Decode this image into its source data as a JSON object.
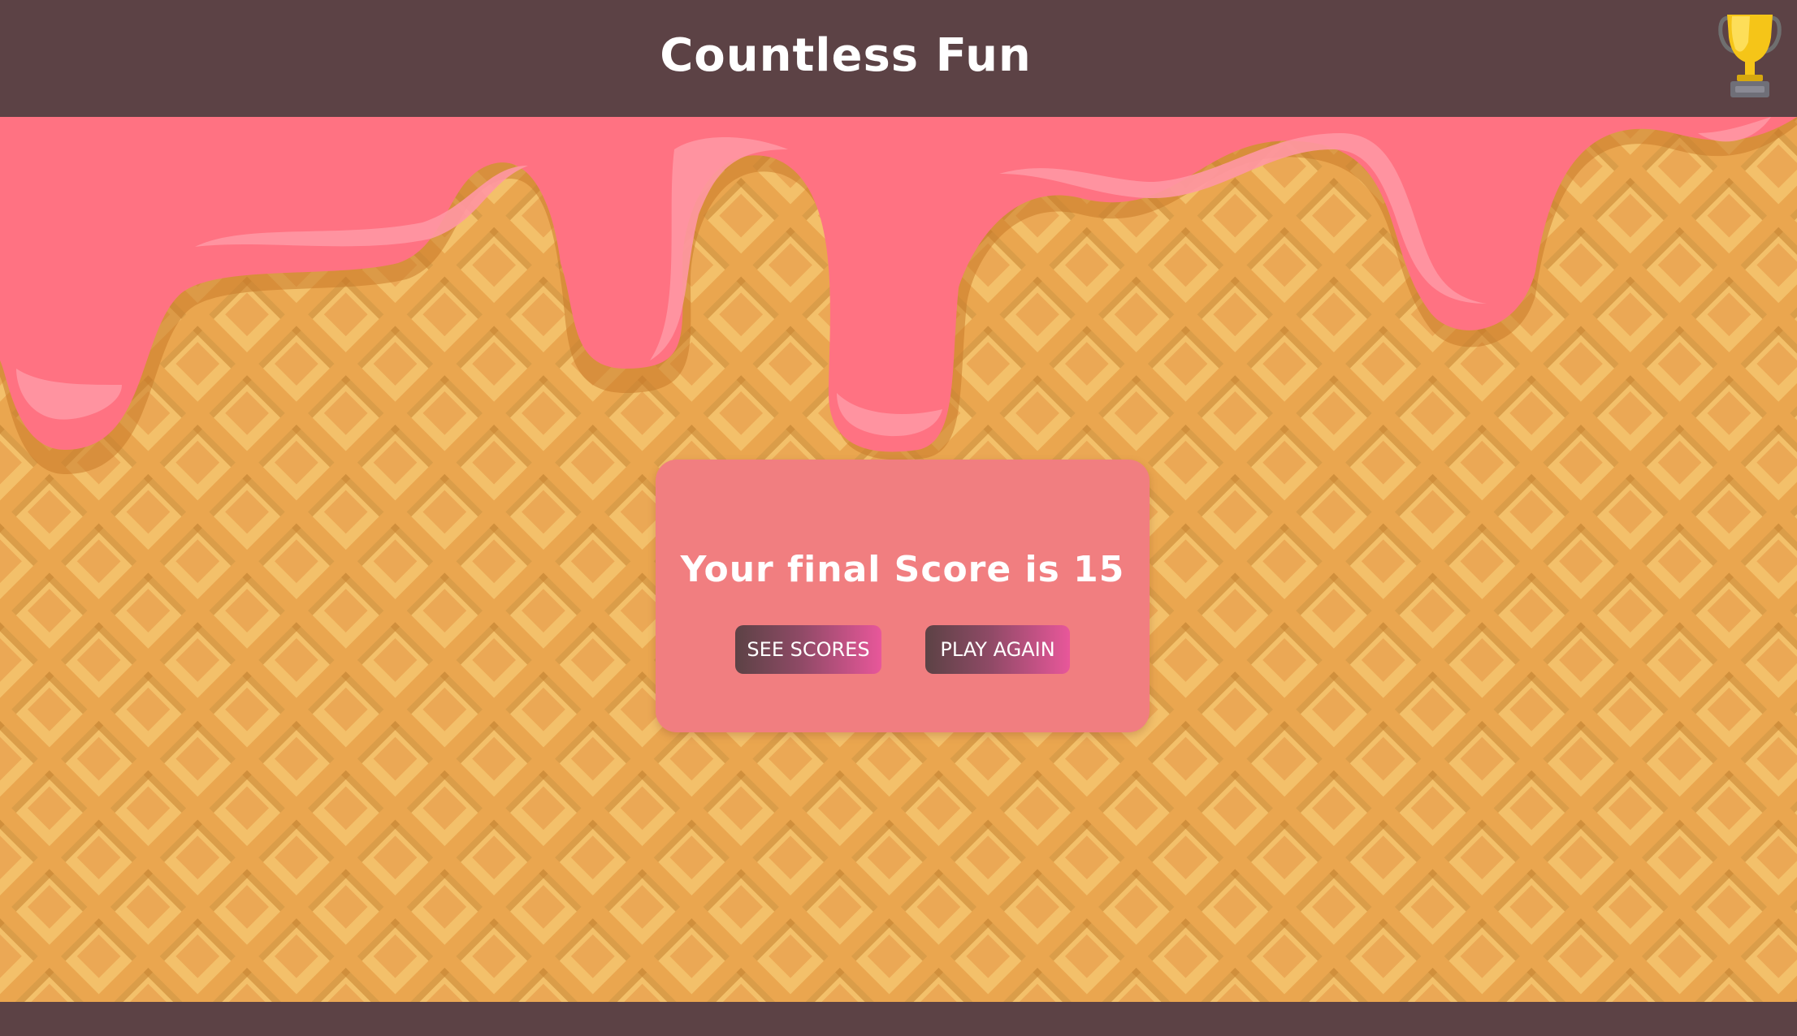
{
  "header": {
    "title": "Countless Fun",
    "trophy_icon": "trophy-icon"
  },
  "result": {
    "score_text": "Your final Score is 15",
    "see_scores_label": "SEE SCORES",
    "play_again_label": "PLAY AGAIN"
  },
  "colors": {
    "header_bg": "#5c4245",
    "icing": "#ff7282",
    "waffle": "#f3c06a",
    "modal_bg": "#f17e80"
  }
}
